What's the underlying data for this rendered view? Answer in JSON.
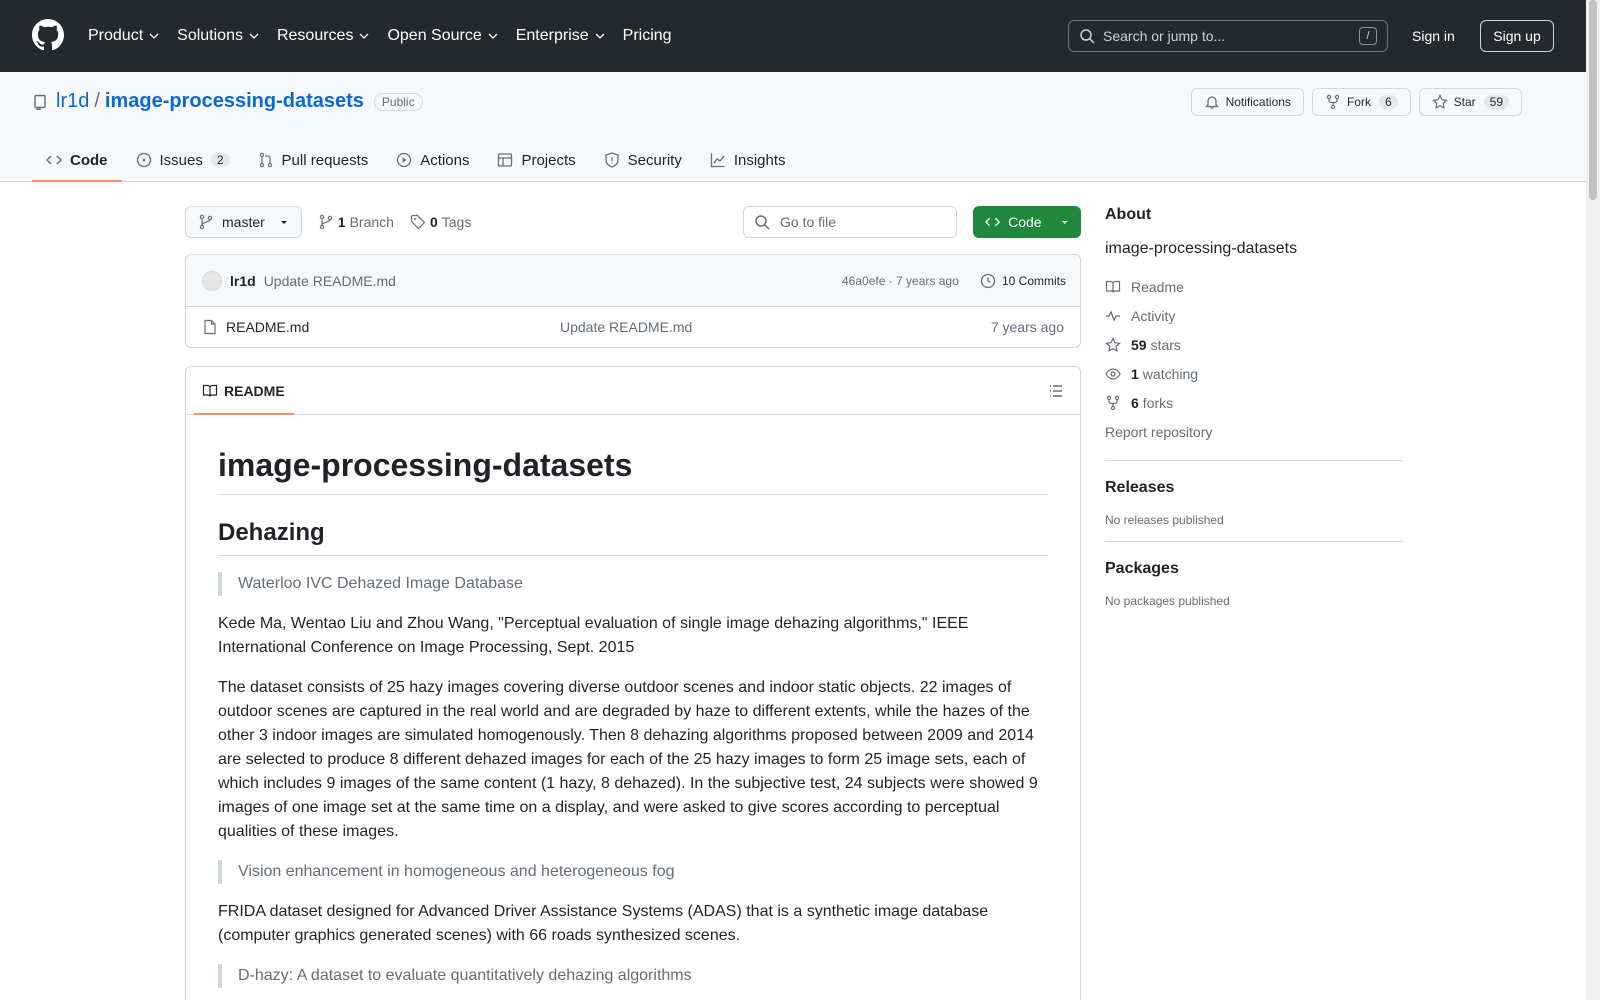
{
  "header": {
    "nav": [
      {
        "label": "Product",
        "dropdown": true
      },
      {
        "label": "Solutions",
        "dropdown": true
      },
      {
        "label": "Resources",
        "dropdown": true
      },
      {
        "label": "Open Source",
        "dropdown": true
      },
      {
        "label": "Enterprise",
        "dropdown": true
      },
      {
        "label": "Pricing",
        "dropdown": false
      }
    ],
    "search_placeholder": "Search or jump to...",
    "search_shortcut": "/",
    "sign_in": "Sign in",
    "sign_up": "Sign up"
  },
  "repo": {
    "owner": "lr1d",
    "separator": "/",
    "name": "image-processing-datasets",
    "visibility": "Public",
    "notifications_label": "Notifications",
    "fork_label": "Fork",
    "fork_count": "6",
    "star_label": "Star",
    "star_count": "59"
  },
  "tabs": [
    {
      "label": "Code",
      "icon": "code-icon",
      "active": true
    },
    {
      "label": "Issues",
      "icon": "issue-icon",
      "count": "2"
    },
    {
      "label": "Pull requests",
      "icon": "pull-request-icon"
    },
    {
      "label": "Actions",
      "icon": "play-icon"
    },
    {
      "label": "Projects",
      "icon": "table-icon"
    },
    {
      "label": "Security",
      "icon": "shield-icon"
    },
    {
      "label": "Insights",
      "icon": "graph-icon"
    }
  ],
  "toolbar": {
    "branch": "master",
    "branch_count": "1",
    "branch_label": "Branch",
    "tag_count": "0",
    "tag_label": "Tags",
    "go_to_file": "Go to file",
    "code_button": "Code"
  },
  "latest_commit": {
    "author": "lr1d",
    "message": "Update README.md",
    "hash_age": "46a0efe · 7 years ago",
    "commits": "10 Commits"
  },
  "files": [
    {
      "name": "README.md",
      "message": "Update README.md",
      "age": "7 years ago"
    }
  ],
  "readme": {
    "tab_label": "README",
    "h1": "image-processing-datasets",
    "h2": "Dehazing",
    "quote1": "Waterloo IVC Dehazed Image Database",
    "para1": "Kede Ma, Wentao Liu and Zhou Wang, \"Perceptual evaluation of single image dehazing algorithms,\" IEEE International Conference on Image Processing, Sept. 2015",
    "para2": "The dataset consists of 25 hazy images covering diverse outdoor scenes and indoor static objects. 22 images of outdoor scenes are captured in the real world and are degraded by haze to different extents, while the hazes of the other 3 indoor images are simulated homogenously. Then 8 dehazing algorithms proposed between 2009 and 2014 are selected to produce 8 different dehazed images for each of the 25 hazy images to form 25 image sets, each of which includes 9 images of the same content (1 hazy, 8 dehazed). In the subjective test, 24 subjects were showed 9 images of one image set at the same time on a display, and were asked to give scores according to perceptual qualities of these images.",
    "quote2": "Vision enhancement in homogeneous and heterogeneous fog",
    "para3": "FRIDA dataset designed for Advanced Driver Assistance Systems (ADAS) that is a synthetic image database (computer graphics generated scenes) with 66 roads synthesized scenes.",
    "quote3": "D-hazy: A dataset to evaluate quantitatively dehazing algorithms"
  },
  "sidebar": {
    "about_title": "About",
    "description": "image-processing-datasets",
    "readme_link": "Readme",
    "activity_link": "Activity",
    "stars_count": "59",
    "stars_label": "stars",
    "watching_count": "1",
    "watching_label": "watching",
    "forks_count": "6",
    "forks_label": "forks",
    "report": "Report repository",
    "releases_title": "Releases",
    "releases_empty": "No releases published",
    "packages_title": "Packages",
    "packages_empty": "No packages published"
  },
  "colors": {
    "header_bg": "#24292f",
    "link": "#0969da",
    "primary_button": "#1f883d",
    "active_tab_underline": "#fd8c73"
  }
}
